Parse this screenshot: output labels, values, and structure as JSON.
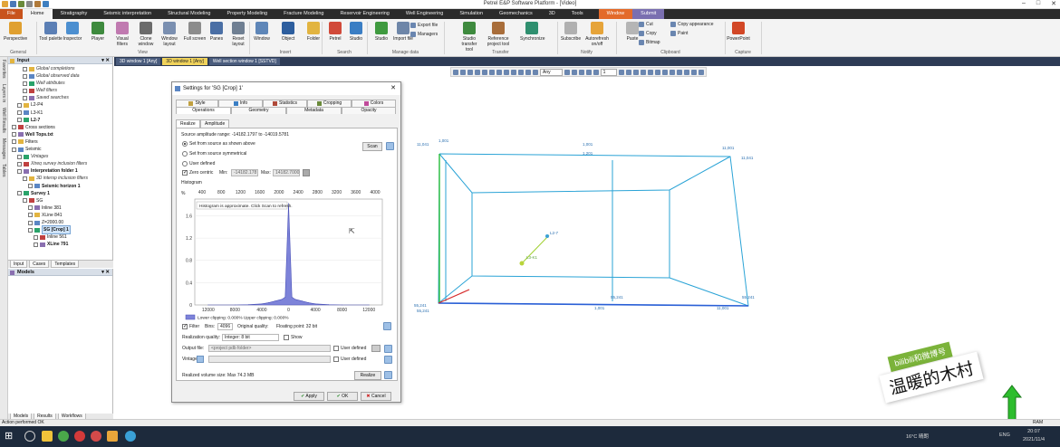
{
  "window": {
    "title": "Petrel E&P Software Platform - [Video]"
  },
  "menubar": {
    "tabs": [
      "File",
      "Home",
      "Stratigraphy",
      "Seismic interpretation",
      "Structural Modeling",
      "Property Modeling",
      "Fracture Modeling",
      "Reservoir Engineering",
      "Well Engineering",
      "Simulation",
      "Geomechanics",
      "3D",
      "Tools"
    ],
    "context_tabs": [
      "Window",
      "Submit"
    ]
  },
  "ribbon": {
    "buttons": [
      {
        "label": "Perspective",
        "color": "#e0a030"
      },
      {
        "label": "Tool palette",
        "color": "#5b7fb5"
      },
      {
        "label": "Inspector",
        "color": "#4c8fd0"
      },
      {
        "label": "Player",
        "color": "#3e8a3e"
      },
      {
        "label": "Visual filters",
        "color": "#c07ab0"
      },
      {
        "label": "Clone window",
        "color": "#6b6b6b"
      },
      {
        "label": "Window layout",
        "color": "#7a8fb0"
      },
      {
        "label": "Full screen",
        "color": "#8c8c8c"
      },
      {
        "label": "Panes",
        "color": "#4a6fa5"
      },
      {
        "label": "Reset layout",
        "color": "#6f7f92"
      },
      {
        "label": "Window",
        "color": "#5e86b8"
      },
      {
        "label": "Object",
        "color": "#2d5e9e"
      },
      {
        "label": "Folder",
        "color": "#e2b440"
      },
      {
        "label": "Petrel",
        "color": "#d14a3a"
      },
      {
        "label": "Studio",
        "color": "#3a7ec4"
      },
      {
        "label": "Studio",
        "color": "#3f9a3f"
      },
      {
        "label": "Import file",
        "color": "#6e86a8"
      },
      {
        "label": "Studio transfer tool",
        "color": "#3e8a3e"
      },
      {
        "label": "Reference project tool",
        "color": "#a86d3a"
      },
      {
        "label": "Synchronize",
        "color": "#2f8f6f"
      },
      {
        "label": "Subscribe",
        "color": "#b0b0b0"
      },
      {
        "label": "Autorefresh on/off",
        "color": "#e6a43a"
      },
      {
        "label": "Paste",
        "color": "#b5b5b5"
      },
      {
        "label": "PowerPoint",
        "color": "#d24726"
      }
    ],
    "small": [
      "Export file",
      "Managers",
      "Cut",
      "Copy",
      "Bitmap",
      "Copy appearance",
      "Paint"
    ],
    "groups": [
      "General",
      "View",
      "Insert",
      "Search",
      "Manage data",
      "Transfer",
      "Notify",
      "Clipboard",
      "Capture"
    ]
  },
  "left_strip": [
    "Favorites",
    "Layers in",
    "Well Results",
    "Messages",
    "Tables"
  ],
  "input_panel": {
    "title": "Input",
    "items": [
      {
        "label": "Global completions",
        "style": "it",
        "indent": 2
      },
      {
        "label": "Global observed data",
        "style": "it",
        "indent": 2
      },
      {
        "label": "Well attributes",
        "style": "it",
        "indent": 2
      },
      {
        "label": "Well filters",
        "style": "it",
        "indent": 2
      },
      {
        "label": "Saved searches",
        "style": "it",
        "indent": 2
      },
      {
        "label": "L2-P4",
        "style": "",
        "indent": 1
      },
      {
        "label": "L3-K1",
        "style": "",
        "indent": 1
      },
      {
        "label": "L2-7",
        "style": "b",
        "indent": 1
      },
      {
        "label": "Cross sections",
        "style": "",
        "indent": 0
      },
      {
        "label": "Well Tops.txt",
        "style": "b",
        "indent": 0
      },
      {
        "label": "Filters",
        "style": "",
        "indent": 0
      },
      {
        "label": "Seismic",
        "style": "",
        "indent": 0
      },
      {
        "label": "Vintages",
        "style": "it",
        "indent": 1
      },
      {
        "label": "Xtreq survey inclusion filters",
        "style": "it",
        "indent": 1
      },
      {
        "label": "Interpretation folder 1",
        "style": "b",
        "indent": 1
      },
      {
        "label": "3D intersp inclusion filters",
        "style": "it",
        "indent": 2
      },
      {
        "label": "Seismic horizon 1",
        "style": "b",
        "indent": 3
      },
      {
        "label": "Survey 1",
        "style": "b",
        "indent": 1
      },
      {
        "label": "SG",
        "style": "",
        "indent": 2
      },
      {
        "label": "Inline 381",
        "style": "",
        "indent": 3
      },
      {
        "label": "XLine 841",
        "style": "",
        "indent": 3
      },
      {
        "label": "Z=2000.00",
        "style": "",
        "indent": 3
      },
      {
        "label": "SG [Crop] 1",
        "style": "b sel",
        "indent": 3
      },
      {
        "label": "Inline 561",
        "style": "",
        "indent": 4
      },
      {
        "label": "XLine 791",
        "style": "b",
        "indent": 4
      }
    ],
    "bottom_tabs": [
      "Input",
      "Cases",
      "Templates"
    ]
  },
  "models_panel": {
    "title": "Models",
    "bottom_tabs": [
      "Models",
      "Results",
      "Workflows"
    ]
  },
  "doc_tabs": [
    "3D window 1 [Any]",
    "3D window 1 [Any]",
    "Well section window 1 [SSTVD]"
  ],
  "view_toolbar": {
    "select": "Any",
    "select2": "1"
  },
  "dialog": {
    "title": "Settings for 'SG [Crop] 1'",
    "tabs_row1": [
      "Style",
      "Info",
      "Statistics",
      "Cropping",
      "Colors"
    ],
    "tabs_row2": [
      "Operations",
      "Geometry",
      "Metadata",
      "Opacity"
    ],
    "subtabs": [
      "Realize",
      "Amplitude"
    ],
    "source_range": "Source amplitude range: -14182.1797 to -14019.5781",
    "radios": [
      "Set from source as shown above",
      "Set from source symmetrical",
      "User defined"
    ],
    "scan_label": "Scan",
    "zero_centric": "Zero centric",
    "min_label": "Min:",
    "min_value": "-14182.178",
    "max_label": "Max:",
    "max_value": "14182.7000",
    "histogram_label": "Histogram",
    "pct": "%",
    "top_axis": [
      "400",
      "800",
      "1200",
      "1600",
      "2000",
      "2400",
      "2800",
      "3200",
      "3600",
      "4000"
    ],
    "y_axis": [
      "1.6",
      "1.2",
      "0.8",
      "0.4",
      "0"
    ],
    "bottom_axis": [
      "12000",
      "8000",
      "4000",
      "0",
      "4000",
      "8000",
      "12000"
    ],
    "histogram_note": "Histogram is approximate. Click Scan to refresh.",
    "legend_text": "Lower clipping: 0.000% Upper clipping: 0.000%",
    "filter_label": "Filter",
    "bins_label": "Bins:",
    "bins_value": "4096",
    "original_quality": "Original quality:",
    "floating_point": "Floating point: 32 bit",
    "realization_quality_label": "Realization quality:",
    "realization_quality_value": "Integer: 8 bit",
    "show_label": "Show",
    "output_file_label": "Output file:",
    "output_file_value": "<project pdb folder>",
    "vintage_label": "Vintage:",
    "user_defined": "User defined",
    "realized_size": "Realized volume size:  Max 74.3 MB",
    "realize_btn": "Realize",
    "apply_btn": "Apply",
    "ok_btn": "OK",
    "cancel_btn": "Cancel"
  },
  "chart_data": {
    "type": "area",
    "title": "Histogram",
    "xlabel": "",
    "ylabel": "%",
    "x": [
      -12000,
      -8000,
      -6000,
      -4000,
      -3000,
      -2000,
      -1000,
      -500,
      0,
      500,
      1000,
      2000,
      3000,
      4000,
      6000,
      8000,
      12000
    ],
    "values": [
      0,
      0,
      0.005,
      0.02,
      0.04,
      0.07,
      0.1,
      0.14,
      1.82,
      0.14,
      0.1,
      0.07,
      0.04,
      0.02,
      0.005,
      0,
      0
    ],
    "xlim": [
      -14000,
      14000
    ],
    "ylim": [
      0,
      1.9
    ],
    "grid": true
  },
  "viewport_labels": [
    "11,041",
    "1,001",
    "1,001",
    "1,201",
    "11,001",
    "11,041",
    "L2-7",
    "L3-K1",
    "55,241",
    "55,241",
    "55,241",
    "11,001",
    "55,241",
    "1,001"
  ],
  "status": {
    "left": "Action performed OK",
    "ram": "RAM"
  },
  "taskbar": {
    "weather": "16°C 晴朗",
    "lang": "ENG",
    "time": "20:07",
    "date": "2021/11/4"
  },
  "watermark": {
    "line1": "bilibili和微博号",
    "line2": "温暖的木村"
  }
}
